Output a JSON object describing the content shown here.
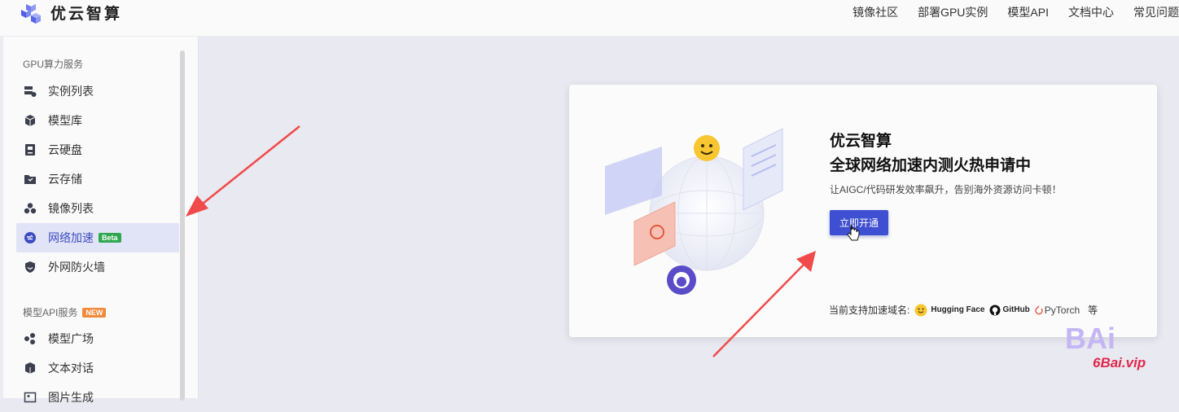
{
  "header": {
    "brand": "优云智算",
    "nav": [
      "镜像社区",
      "部署GPU实例",
      "模型API",
      "文档中心",
      "常见问题"
    ]
  },
  "sidebar": {
    "gpu_section": "GPU算力服务",
    "gpu_items": [
      {
        "label": "实例列表",
        "icon": "server-icon"
      },
      {
        "label": "模型库",
        "icon": "cube-icon"
      },
      {
        "label": "云硬盘",
        "icon": "disk-icon"
      },
      {
        "label": "云存储",
        "icon": "folder-icon"
      },
      {
        "label": "镜像列表",
        "icon": "layers-icon"
      },
      {
        "label": "网络加速",
        "icon": "speed-icon",
        "badge": "Beta",
        "active": true
      },
      {
        "label": "外网防火墙",
        "icon": "shield-icon"
      }
    ],
    "api_section": "模型API服务",
    "api_badge": "NEW",
    "api_items": [
      {
        "label": "模型广场",
        "icon": "apps-icon"
      },
      {
        "label": "文本对话",
        "icon": "chat-icon"
      },
      {
        "label": "图片生成",
        "icon": "image-icon"
      }
    ]
  },
  "promo": {
    "title_line1": "优云智算",
    "title_line2": "全球网络加速内测火热申请中",
    "subtitle": "让AIGC/代码研发效率飙升，告别海外资源访问卡顿！",
    "cta_label": "立即开通",
    "domains_label": "当前支持加速域名:",
    "domains": [
      "Hugging Face",
      "GitHub",
      "PyTorch"
    ],
    "domains_suffix": "等"
  },
  "watermark": {
    "logo_text": "BAi",
    "url": "6Bai.vip"
  },
  "colors": {
    "accent": "#3f4fd1",
    "active_bg": "#e1e3f6",
    "beta": "#2ea84f",
    "new": "#f08a3c",
    "arrow": "#f04a4a"
  }
}
